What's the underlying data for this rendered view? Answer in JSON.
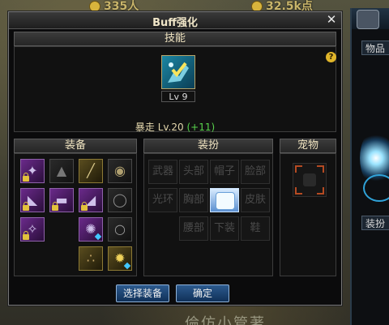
{
  "background": {
    "stat_left": "335人",
    "stat_right": "32.5k点",
    "bottom_text": "倫仿小管著"
  },
  "side_panel": {
    "tab_items": "物品",
    "tab_avatar": "装扮"
  },
  "dialog": {
    "title": "Buff强化",
    "close_label": "✕",
    "skill_section": "技能",
    "skill": {
      "level_badge": "Lv 9",
      "name": "暴走",
      "level": "Lv.20",
      "bonus": "(+11)",
      "icon": "rampage-skill-icon"
    },
    "help_label": "?",
    "equipment_section": "装备",
    "avatar_section": "装扮",
    "pet_section": "宠物",
    "avatar_slots": [
      "武器",
      "头部",
      "帽子",
      "脸部",
      "光环",
      "胸部",
      "",
      "皮肤",
      "腰部",
      "下装",
      "鞋"
    ],
    "buttons": {
      "select_equipment": "选择装备",
      "confirm": "确定"
    },
    "colors": {
      "title_text": "#f0e6c8",
      "bonus_green": "#58d24c",
      "button_blue": "#1c4a7e"
    }
  }
}
